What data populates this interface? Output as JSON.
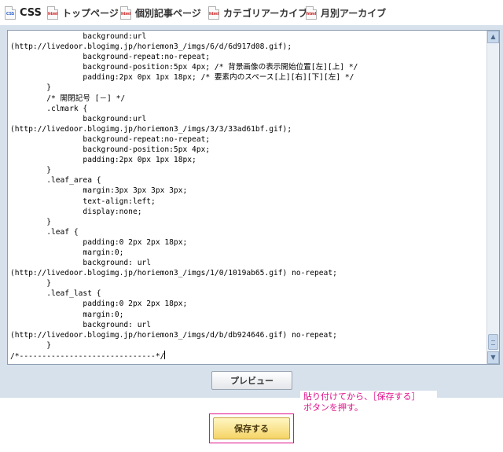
{
  "tabs": [
    {
      "label": "CSS",
      "icon": "css-file-icon",
      "icon_text": "CSS"
    },
    {
      "label": "トップページ",
      "icon": "html-file-icon",
      "icon_text": "html"
    },
    {
      "label": "個別記事ページ",
      "icon": "html-file-icon",
      "icon_text": "html"
    },
    {
      "label": "カテゴリアーカイブ",
      "icon": "html-file-icon",
      "icon_text": "html"
    },
    {
      "label": "月別アーカイブ",
      "icon": "html-file-icon",
      "icon_text": "html"
    }
  ],
  "editor": {
    "lines": [
      "                background:url",
      "(http://livedoor.blogimg.jp/horiemon3_/imgs/6/d/6d917d08.gif);",
      "                background-repeat:no-repeat;",
      "                background-position:5px 4px; /* 背景画像の表示開始位置[左][上] */",
      "                padding:2px 0px 1px 18px; /* 要素内のスペース[上][右][下][左] */",
      "        }",
      "        /* 開閉記号 [－] */",
      "        .clmark {",
      "                background:url",
      "(http://livedoor.blogimg.jp/horiemon3_/imgs/3/3/33ad61bf.gif);",
      "                background-repeat:no-repeat;",
      "                background-position:5px 4px;",
      "                padding:2px 0px 1px 18px;",
      "        }",
      "        .leaf_area {",
      "                margin:3px 3px 3px 3px;",
      "                text-align:left;",
      "                display:none;",
      "        }",
      "        .leaf {",
      "                padding:0 2px 2px 18px;",
      "                margin:0;",
      "                background: url",
      "(http://livedoor.blogimg.jp/horiemon3_/imgs/1/0/1019ab65.gif) no-repeat;",
      "        }",
      "        .leaf_last {",
      "                padding:0 2px 2px 18px;",
      "                margin:0;",
      "                background: url",
      "(http://livedoor.blogimg.jp/horiemon3_/imgs/d/b/db924646.gif) no-repeat;",
      "        }",
      "/*------------------------------*/"
    ]
  },
  "preview_button": {
    "label": "プレビュー"
  },
  "annotation": {
    "line1": "貼り付けてから、［保存する］",
    "line2": "ボタンを押す。",
    "color": "#e0118c"
  },
  "save_button": {
    "label": "保存する"
  },
  "colors": {
    "panel": "#d6e1ec",
    "accent": "#e0118c"
  }
}
